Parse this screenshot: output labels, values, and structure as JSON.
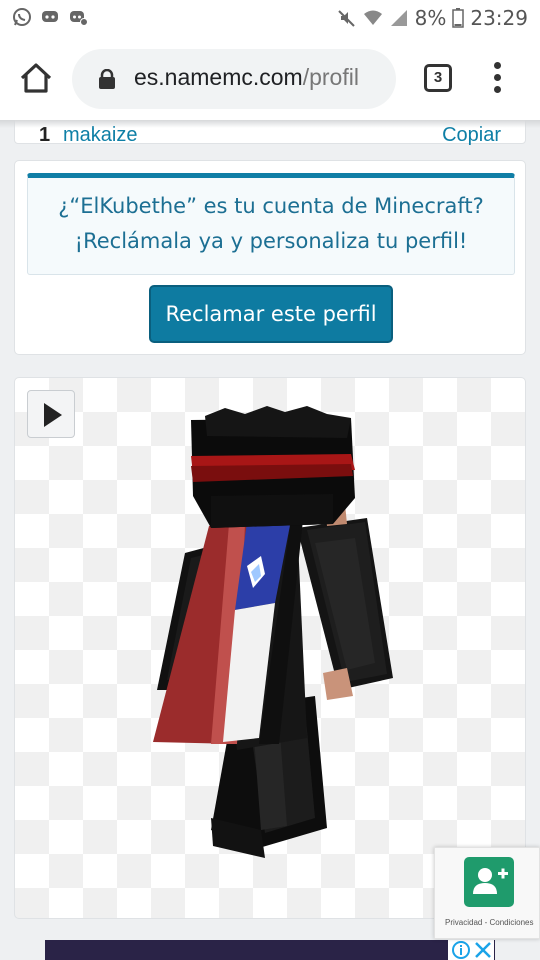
{
  "status_bar": {
    "left_icons": [
      "whatsapp-icon",
      "discord-icon",
      "discord-icon"
    ],
    "battery_percent": "8%",
    "time": "23:29"
  },
  "browser": {
    "url_domain": "es.namemc.com",
    "url_path": "/profil",
    "tab_count": "3"
  },
  "clipped_row": {
    "rank": "1",
    "name": "makaize",
    "action": "Copiar"
  },
  "claim": {
    "line1": "¿“ElKubethe” es tu cuenta de Minecraft?",
    "line2": "¡Reclámala ya y personaliza tu perfil!",
    "button_label": "Reclamar este perfil"
  },
  "skin_viewer": {
    "play_icon": "play-icon",
    "add_friend_icon": "add-friend-icon"
  },
  "recaptcha": {
    "text": "Privacidad - Condiciones"
  },
  "colors": {
    "accent": "#0e7ba1",
    "link": "#0e7fa6",
    "success": "#1f9b6c"
  }
}
